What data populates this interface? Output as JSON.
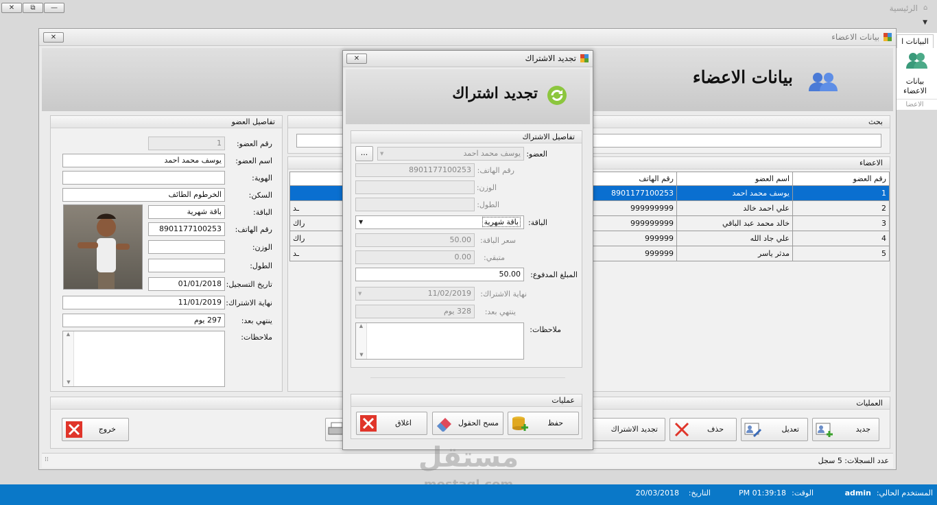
{
  "main_window": {
    "title": "الرئيسية"
  },
  "ribbon": {
    "tab": "البيانات ا",
    "button_label_1": "بيانات",
    "button_label_2": "الاعضاء",
    "group_label": "الاعضا"
  },
  "members_window": {
    "title": "بيانات الاعضاء",
    "header_title": "بيانات الاعضاء",
    "details_group": "تفاصيل العضو",
    "fields": {
      "id_label": "رقم العضو:",
      "id_value": "1",
      "name_label": "اسم العضو:",
      "name_value": "يوسف محمد احمد",
      "identity_label": "الهوية:",
      "identity_value": "",
      "residence_label": "السكن:",
      "residence_value": "الخرطوم الطائف",
      "package_label": "الباقة:",
      "package_value": "باقة شهرية",
      "phone_label": "رقم الهاتف:",
      "phone_value": "8901177100253",
      "weight_label": "الوزن:",
      "weight_value": "",
      "height_label": "الطول:",
      "height_value": "",
      "reg_date_label": "تاريخ التسجيل:",
      "reg_date_value": "01/01/2018",
      "sub_end_label": "نهاية الاشتراك:",
      "sub_end_value": "11/01/2019",
      "expires_label": "ينتهي بعد:",
      "expires_value": "297 يوم",
      "notes_label": "ملاحظات:"
    },
    "search_group": "بحث",
    "search_value": "",
    "members_group": "الاعضاء",
    "table": {
      "headers": [
        "رقم العضو",
        "اسم العضو",
        "رقم الهاتف"
      ],
      "rows": [
        {
          "id": "1",
          "name": "يوسف محمد احمد",
          "phone": "8901177100253",
          "edge": ""
        },
        {
          "id": "2",
          "name": "علي احمد خالد",
          "phone": "999999999",
          "edge": "ـد"
        },
        {
          "id": "3",
          "name": "خالد محمد عبد الباقي",
          "phone": "999999999",
          "edge": "راك"
        },
        {
          "id": "4",
          "name": "علي جاد الله",
          "phone": "999999",
          "edge": "راك"
        },
        {
          "id": "5",
          "name": "مدثر ياسر",
          "phone": "999999",
          "edge": "ـد"
        }
      ]
    },
    "ops_group": "العمليات",
    "buttons": {
      "new": "جديد",
      "edit": "تعديل",
      "delete": "حذف",
      "renew": "تجديد الاشتراك",
      "exit": "خروج"
    },
    "record_count": "عدد السجلات:  5 سجل"
  },
  "dialog": {
    "title": "تجديد الاشتراك",
    "header_title": "تجديد اشتراك",
    "group": "تفاصيل الاشتراك",
    "member_label": "العضو:",
    "member_value": "يوسف محمد احمد",
    "browse_label": "...",
    "phone_label": "رقم الهاتف:",
    "phone_value": "8901177100253",
    "weight_label": "الوزن:",
    "weight_value": "",
    "height_label": "الطول:",
    "height_value": "",
    "package_label": "الباقة:",
    "package_value": "باقة شهرية",
    "price_label": "سعر الباقة:",
    "price_value": "50.00",
    "remaining_label": "متبقي:",
    "remaining_value": "0.00",
    "paid_label": "المبلغ المدفوع:",
    "paid_value": "50.00",
    "end_label": "نهاية الاشتراك:",
    "end_value": "11/02/2019",
    "expires_label": "ينتهي بعد:",
    "expires_value": "328 يوم",
    "notes_label": "ملاحظات:",
    "ops_group": "عمليات",
    "save": "حفظ",
    "clear": "مسح الحقول",
    "close": "اغلاق"
  },
  "status_bar": {
    "user_label": "المستخدم الحالي:",
    "user_value": "admin",
    "time_label": "الوقت:",
    "time_value": "PM 01:39:18",
    "date_label": "التاريخ:",
    "date_value": "20/03/2018"
  },
  "watermark": {
    "text": "مستقل",
    "url": "mostaql.com"
  },
  "colors": {
    "selection": "#0a6fd0",
    "status_bar": "#0a78c8",
    "delete_red": "#e0352a"
  }
}
